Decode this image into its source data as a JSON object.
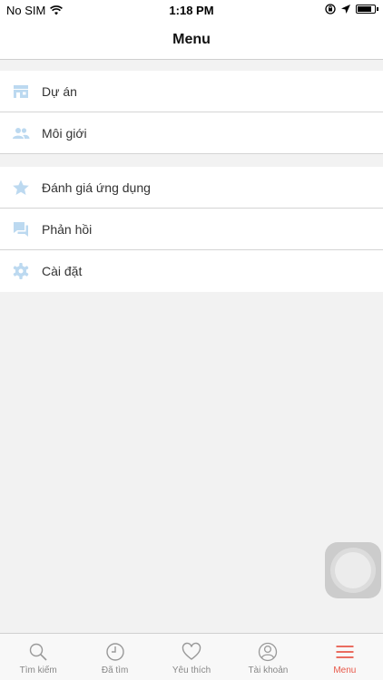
{
  "status_bar": {
    "carrier": "No SIM",
    "time": "1:18 PM"
  },
  "nav": {
    "title": "Menu"
  },
  "menu": {
    "group1": [
      {
        "label": "Dự án",
        "icon": "building-icon"
      },
      {
        "label": "Môi giới",
        "icon": "people-icon"
      }
    ],
    "group2": [
      {
        "label": "Đánh giá ứng dụng",
        "icon": "star-icon"
      },
      {
        "label": "Phản hồi",
        "icon": "chat-icon"
      },
      {
        "label": "Cài đặt",
        "icon": "gear-icon"
      }
    ]
  },
  "tab_bar": {
    "tabs": [
      {
        "label": "Tìm kiếm",
        "icon": "search-icon"
      },
      {
        "label": "Đã tìm",
        "icon": "clock-icon"
      },
      {
        "label": "Yêu thích",
        "icon": "heart-icon"
      },
      {
        "label": "Tài khoản",
        "icon": "user-icon"
      },
      {
        "label": "Menu",
        "icon": "menu-icon"
      }
    ],
    "active_index": 4
  },
  "colors": {
    "icon_blue": "#bcd9f0",
    "active_tab": "#e8594a",
    "inactive_tab": "#888888",
    "background": "#f2f2f2"
  }
}
